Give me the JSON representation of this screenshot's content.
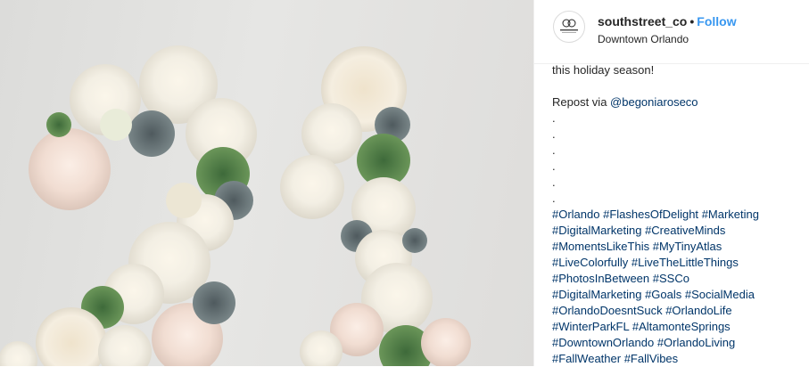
{
  "post": {
    "author": {
      "username": "southstreet_co",
      "separator": "•",
      "follow_label": "Follow",
      "location": "Downtown Orlando",
      "avatar_text": "SOUTH STREET & CO."
    },
    "caption": {
      "intro": "this holiday season!",
      "repost_prefix": "Repost via ",
      "repost_handle": "@begoniaroseco",
      "dots": [
        ".",
        ".",
        ".",
        ".",
        ".",
        "."
      ],
      "hashtag_lines": [
        [
          "#Orlando",
          "#FlashesOfDelight",
          "#Marketing"
        ],
        [
          "#DigitalMarketing",
          "#CreativeMinds"
        ],
        [
          "#MomentsLikeThis",
          "#MyTinyAtlas"
        ],
        [
          "#LiveColorfully",
          "#LiveTheLittleThings"
        ],
        [
          "#PhotosInBetween",
          "#SSCo"
        ],
        [
          "#DigitalMarketing",
          "#Goals",
          "#SocialMedia"
        ],
        [
          "#OrlandoDoesntSuck",
          "#OrlandoLife"
        ],
        [
          "#WinterParkFL",
          "#AltamonteSprings"
        ],
        [
          "#DowntownOrlando",
          "#OrlandoLiving"
        ],
        [
          "#FallWeather",
          "#FallVibes"
        ]
      ]
    }
  },
  "colors": {
    "follow": "#3897f0",
    "hashtag": "#003569",
    "text": "#262626",
    "divider": "#efefef"
  },
  "photo": {
    "icon": "floral-number-photo"
  }
}
